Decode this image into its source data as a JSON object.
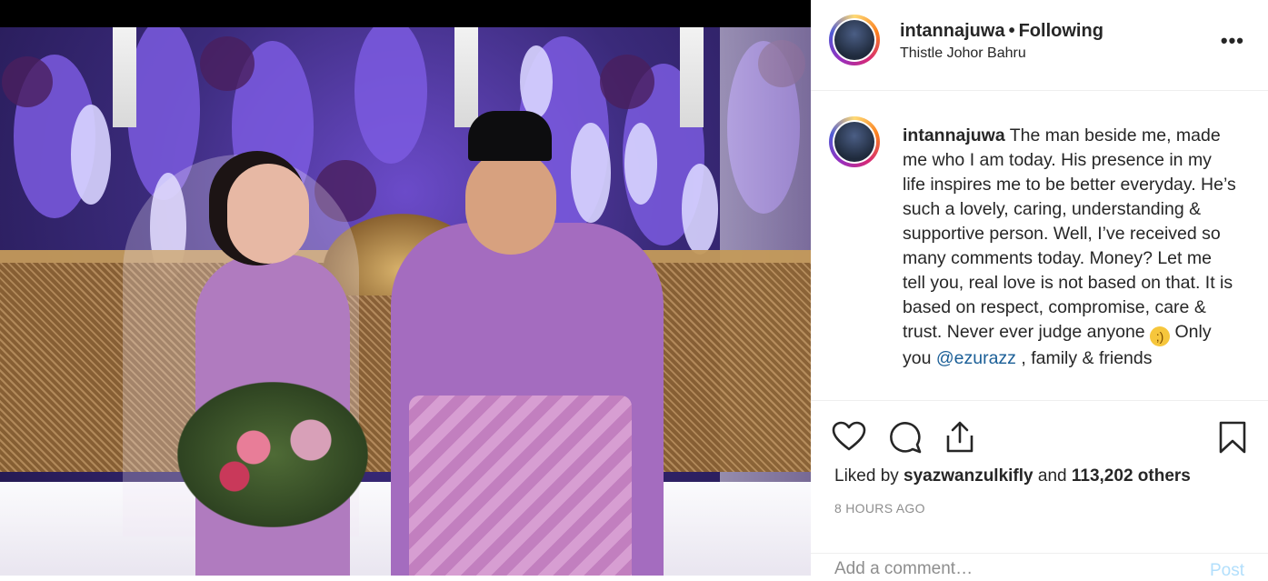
{
  "post": {
    "username": "intannajuwa",
    "separator": "•",
    "follow_status": "Following",
    "location": "Thistle Johor Bahru",
    "more_icon": "more-options-icon"
  },
  "caption": {
    "username": "intannajuwa",
    "text_part1": " The man beside me, made me who I am today. His presence in my life inspires me to be better everyday. He’s such a lovely, caring, understanding & supportive person. Well, I’ve received so many comments today. Money? Let me tell you, real love is not based on that. It is based on respect, compromise, care & trust. Never ever judge anyone ",
    "emoji": "wink-emoji",
    "text_part2": " Only you ",
    "mention": "@ezurazz",
    "text_part3": " , family & friends"
  },
  "actions": {
    "icons": [
      "heart-icon",
      "comment-icon",
      "share-icon",
      "bookmark-icon"
    ]
  },
  "likes": {
    "prefix": "Liked by ",
    "liker": "syazwanzulkifly",
    "middle": " and ",
    "count": "113,202 others"
  },
  "timestamp": "8 HOURS AGO",
  "comment_box": {
    "placeholder": "Add a comment…",
    "post_label": "Post"
  },
  "colors": {
    "mention": "#1b5f97",
    "post_disabled": "#b2dffc",
    "muted": "#8e8e8e"
  }
}
